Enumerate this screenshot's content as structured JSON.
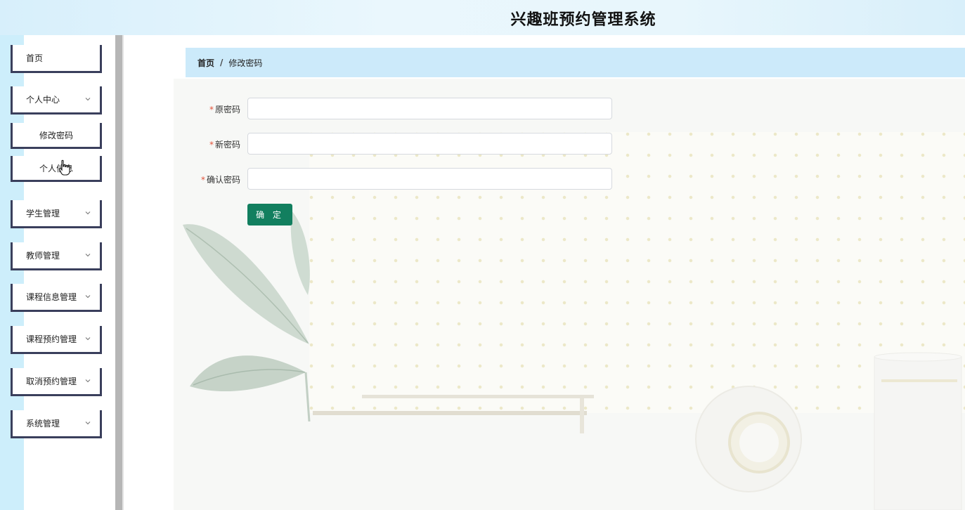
{
  "app": {
    "title": "兴趣班预约管理系统"
  },
  "sidebar": {
    "items": [
      {
        "label": "首页",
        "has_chevron": false
      },
      {
        "label": "个人中心",
        "has_chevron": true,
        "expanded": true
      },
      {
        "label": "学生管理",
        "has_chevron": true
      },
      {
        "label": "教师管理",
        "has_chevron": true
      },
      {
        "label": "课程信息管理",
        "has_chevron": true
      },
      {
        "label": "课程预约管理",
        "has_chevron": true
      },
      {
        "label": "取消预约管理",
        "has_chevron": true
      },
      {
        "label": "系统管理",
        "has_chevron": true
      }
    ],
    "subitems": [
      {
        "label": "修改密码",
        "active": true
      },
      {
        "label": "个人信息"
      }
    ]
  },
  "breadcrumb": {
    "home": "首页",
    "separator": "/",
    "current": "修改密码"
  },
  "form": {
    "required_mark": "*",
    "fields": [
      {
        "label": "原密码",
        "value": ""
      },
      {
        "label": "新密码",
        "value": ""
      },
      {
        "label": "确认密码",
        "value": ""
      }
    ],
    "submit_label": "确 定"
  },
  "colors": {
    "accent": "#127f5f",
    "breadcrumb_bg": "#cceafa",
    "menu_border": "#3a3f5c",
    "required": "#e2533a"
  },
  "icons": [
    "chevron-down-icon",
    "hand-pointer-icon"
  ]
}
